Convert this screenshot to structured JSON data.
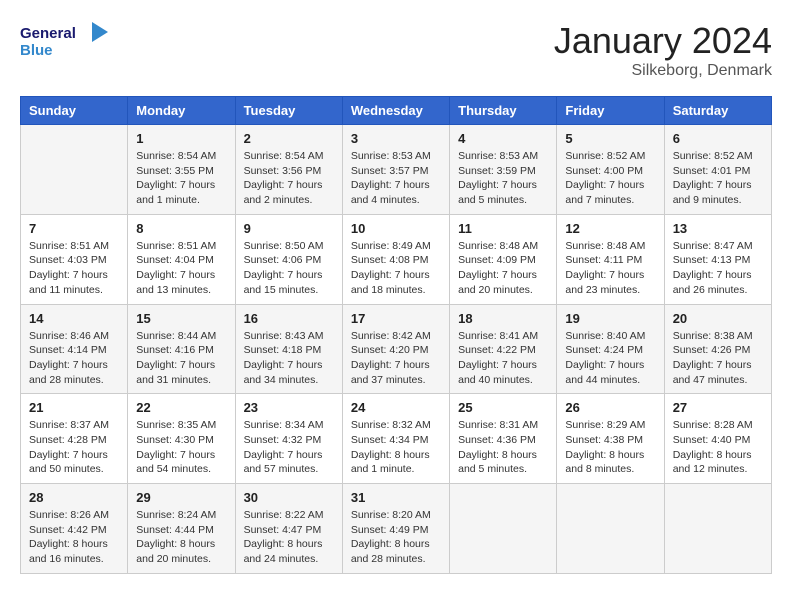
{
  "header": {
    "logo_general": "General",
    "logo_blue": "Blue",
    "month_title": "January 2024",
    "location": "Silkeborg, Denmark"
  },
  "calendar": {
    "days_of_week": [
      "Sunday",
      "Monday",
      "Tuesday",
      "Wednesday",
      "Thursday",
      "Friday",
      "Saturday"
    ],
    "weeks": [
      [
        {
          "day": "",
          "info": ""
        },
        {
          "day": "1",
          "info": "Sunrise: 8:54 AM\nSunset: 3:55 PM\nDaylight: 7 hours\nand 1 minute."
        },
        {
          "day": "2",
          "info": "Sunrise: 8:54 AM\nSunset: 3:56 PM\nDaylight: 7 hours\nand 2 minutes."
        },
        {
          "day": "3",
          "info": "Sunrise: 8:53 AM\nSunset: 3:57 PM\nDaylight: 7 hours\nand 4 minutes."
        },
        {
          "day": "4",
          "info": "Sunrise: 8:53 AM\nSunset: 3:59 PM\nDaylight: 7 hours\nand 5 minutes."
        },
        {
          "day": "5",
          "info": "Sunrise: 8:52 AM\nSunset: 4:00 PM\nDaylight: 7 hours\nand 7 minutes."
        },
        {
          "day": "6",
          "info": "Sunrise: 8:52 AM\nSunset: 4:01 PM\nDaylight: 7 hours\nand 9 minutes."
        }
      ],
      [
        {
          "day": "7",
          "info": "Sunrise: 8:51 AM\nSunset: 4:03 PM\nDaylight: 7 hours\nand 11 minutes."
        },
        {
          "day": "8",
          "info": "Sunrise: 8:51 AM\nSunset: 4:04 PM\nDaylight: 7 hours\nand 13 minutes."
        },
        {
          "day": "9",
          "info": "Sunrise: 8:50 AM\nSunset: 4:06 PM\nDaylight: 7 hours\nand 15 minutes."
        },
        {
          "day": "10",
          "info": "Sunrise: 8:49 AM\nSunset: 4:08 PM\nDaylight: 7 hours\nand 18 minutes."
        },
        {
          "day": "11",
          "info": "Sunrise: 8:48 AM\nSunset: 4:09 PM\nDaylight: 7 hours\nand 20 minutes."
        },
        {
          "day": "12",
          "info": "Sunrise: 8:48 AM\nSunset: 4:11 PM\nDaylight: 7 hours\nand 23 minutes."
        },
        {
          "day": "13",
          "info": "Sunrise: 8:47 AM\nSunset: 4:13 PM\nDaylight: 7 hours\nand 26 minutes."
        }
      ],
      [
        {
          "day": "14",
          "info": "Sunrise: 8:46 AM\nSunset: 4:14 PM\nDaylight: 7 hours\nand 28 minutes."
        },
        {
          "day": "15",
          "info": "Sunrise: 8:44 AM\nSunset: 4:16 PM\nDaylight: 7 hours\nand 31 minutes."
        },
        {
          "day": "16",
          "info": "Sunrise: 8:43 AM\nSunset: 4:18 PM\nDaylight: 7 hours\nand 34 minutes."
        },
        {
          "day": "17",
          "info": "Sunrise: 8:42 AM\nSunset: 4:20 PM\nDaylight: 7 hours\nand 37 minutes."
        },
        {
          "day": "18",
          "info": "Sunrise: 8:41 AM\nSunset: 4:22 PM\nDaylight: 7 hours\nand 40 minutes."
        },
        {
          "day": "19",
          "info": "Sunrise: 8:40 AM\nSunset: 4:24 PM\nDaylight: 7 hours\nand 44 minutes."
        },
        {
          "day": "20",
          "info": "Sunrise: 8:38 AM\nSunset: 4:26 PM\nDaylight: 7 hours\nand 47 minutes."
        }
      ],
      [
        {
          "day": "21",
          "info": "Sunrise: 8:37 AM\nSunset: 4:28 PM\nDaylight: 7 hours\nand 50 minutes."
        },
        {
          "day": "22",
          "info": "Sunrise: 8:35 AM\nSunset: 4:30 PM\nDaylight: 7 hours\nand 54 minutes."
        },
        {
          "day": "23",
          "info": "Sunrise: 8:34 AM\nSunset: 4:32 PM\nDaylight: 7 hours\nand 57 minutes."
        },
        {
          "day": "24",
          "info": "Sunrise: 8:32 AM\nSunset: 4:34 PM\nDaylight: 8 hours\nand 1 minute."
        },
        {
          "day": "25",
          "info": "Sunrise: 8:31 AM\nSunset: 4:36 PM\nDaylight: 8 hours\nand 5 minutes."
        },
        {
          "day": "26",
          "info": "Sunrise: 8:29 AM\nSunset: 4:38 PM\nDaylight: 8 hours\nand 8 minutes."
        },
        {
          "day": "27",
          "info": "Sunrise: 8:28 AM\nSunset: 4:40 PM\nDaylight: 8 hours\nand 12 minutes."
        }
      ],
      [
        {
          "day": "28",
          "info": "Sunrise: 8:26 AM\nSunset: 4:42 PM\nDaylight: 8 hours\nand 16 minutes."
        },
        {
          "day": "29",
          "info": "Sunrise: 8:24 AM\nSunset: 4:44 PM\nDaylight: 8 hours\nand 20 minutes."
        },
        {
          "day": "30",
          "info": "Sunrise: 8:22 AM\nSunset: 4:47 PM\nDaylight: 8 hours\nand 24 minutes."
        },
        {
          "day": "31",
          "info": "Sunrise: 8:20 AM\nSunset: 4:49 PM\nDaylight: 8 hours\nand 28 minutes."
        },
        {
          "day": "",
          "info": ""
        },
        {
          "day": "",
          "info": ""
        },
        {
          "day": "",
          "info": ""
        }
      ]
    ]
  }
}
